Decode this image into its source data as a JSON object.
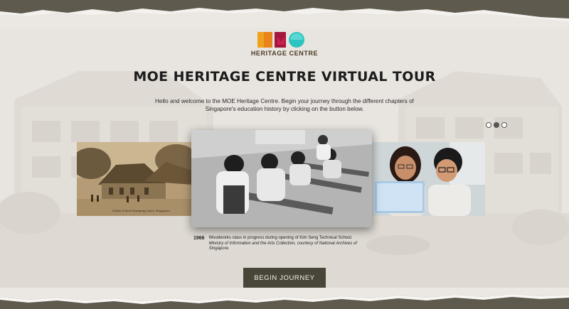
{
  "brand": {
    "logo_label": "MOE Heritage Centre logo",
    "logo_text": "HERITAGE CENTRE",
    "colors": {
      "orange": "#f0a21c",
      "red": "#a3173d",
      "teal": "#2cc3c0"
    }
  },
  "page": {
    "title": "MOE HERITAGE CENTRE VIRTUAL TOUR",
    "intro": "Hello and welcome to the MOE Heritage Centre. Begin your journey through the different chapters of Singapore's education history by clicking on the button below."
  },
  "carousel": {
    "active_index": 1,
    "dot_count": 3,
    "slides": [
      {
        "name": "old-village-school-photo",
        "caption_overlay": "Malay School Kampong Ayer, Singapore"
      },
      {
        "name": "woodworks-class-photo"
      },
      {
        "name": "students-laptop-photo"
      }
    ],
    "caption": {
      "year": "1966",
      "text": "Woodworks class in progress during opening of Kim Seng Technical School.",
      "credit": "Ministry of Information and the Arts Collection, courtesy of National Archives of Singapore."
    }
  },
  "cta": {
    "label": "BEGIN JOURNEY"
  }
}
